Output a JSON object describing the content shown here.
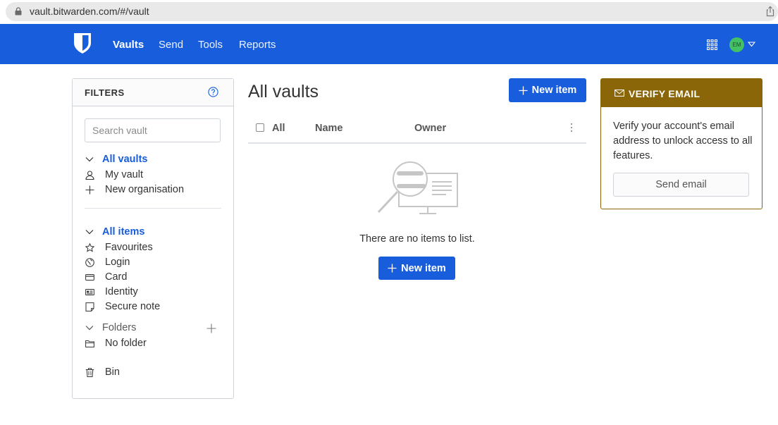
{
  "browser": {
    "url": "vault.bitwarden.com/#/vault"
  },
  "nav": {
    "links": [
      "Vaults",
      "Send",
      "Tools",
      "Reports"
    ],
    "avatar_initials": "EM",
    "brand_color": "#175ddc"
  },
  "filters": {
    "title": "FILTERS",
    "search_placeholder": "Search vault",
    "vaults": {
      "label": "All vaults",
      "items": [
        "My vault",
        "New organisation"
      ]
    },
    "types": {
      "label": "All items",
      "items": [
        "Favourites",
        "Login",
        "Card",
        "Identity",
        "Secure note"
      ]
    },
    "folders": {
      "label": "Folders",
      "items": [
        "No folder"
      ]
    },
    "bin": "Bin"
  },
  "main": {
    "title": "All vaults",
    "new_item": "New item",
    "columns": {
      "all": "All",
      "name": "Name",
      "owner": "Owner"
    },
    "empty_text": "There are no items to list.",
    "empty_button": "New item"
  },
  "verify": {
    "title": "VERIFY EMAIL",
    "body": "Verify your account's email address to unlock access to all features.",
    "button": "Send email",
    "accent": "#8b6609"
  }
}
